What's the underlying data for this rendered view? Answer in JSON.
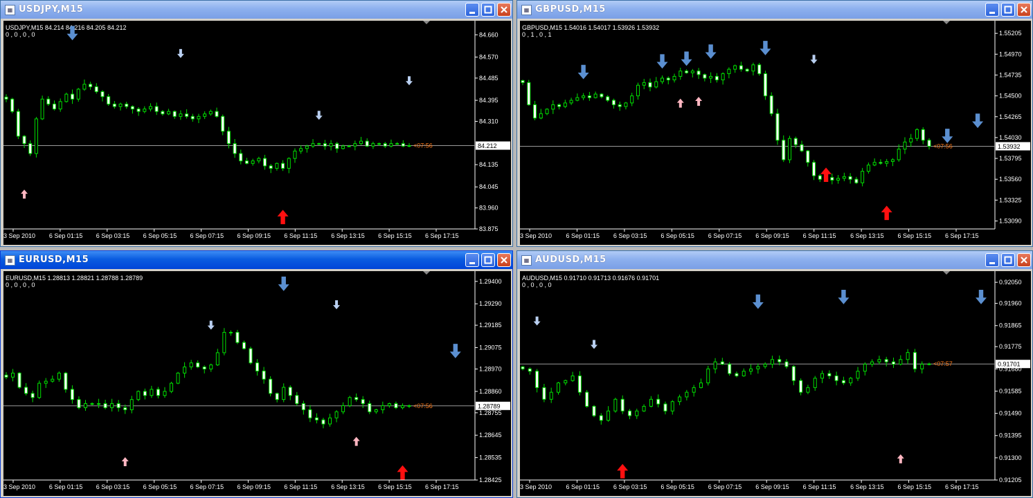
{
  "colors": {
    "bull": "#00ff00",
    "bear": "#ffffff",
    "wick": "#00e000",
    "axis": "#ffffff",
    "bidline": "#9a9a9a",
    "timer": "#ff7a1a",
    "up_light": "#ffb6c1",
    "up_bold": "#ff1010",
    "down_light": "#b9cff0",
    "down_bold": "#5b8fd0"
  },
  "icons": {
    "window": "chart-window-icon",
    "minimize": "minimize-icon",
    "maximize": "maximize-icon",
    "close": "close-icon"
  },
  "windows": [
    {
      "title": "USDJPY,M15",
      "active": false,
      "info_line1": "USDJPY,M15  84.214 84.216 84.205 84.212",
      "info_line2": "0 , 0 , 0 , 0",
      "price_labels": [
        "84.660",
        "84.570",
        "84.485",
        "84.395",
        "84.310",
        "84.135",
        "84.045",
        "83.960",
        "83.875"
      ],
      "bid_label": "84.212",
      "timer": "<07:56",
      "time_labels": [
        "3 Sep 2010",
        "6 Sep 01:15",
        "6 Sep 03:15",
        "6 Sep 05:15",
        "6 Sep 07:15",
        "6 Sep 09:15",
        "6 Sep 11:15",
        "6 Sep 13:15",
        "6 Sep 15:15",
        "6 Sep 17:15"
      ],
      "ymin": 83.875,
      "ymax": 84.7,
      "bid": 84.212,
      "series": [
        84.4,
        84.35,
        84.25,
        84.22,
        84.18,
        84.32,
        84.4,
        84.38,
        84.36,
        84.39,
        84.42,
        84.4,
        84.44,
        84.46,
        84.45,
        84.43,
        84.41,
        84.38,
        84.37,
        84.38,
        84.37,
        84.36,
        84.35,
        84.36,
        84.37,
        84.35,
        84.34,
        84.35,
        84.33,
        84.34,
        84.33,
        84.32,
        84.33,
        84.34,
        84.35,
        84.33,
        84.27,
        84.22,
        84.18,
        84.15,
        84.14,
        84.15,
        84.16,
        84.13,
        84.12,
        84.14,
        84.12,
        84.16,
        84.19,
        84.2,
        84.21,
        84.22,
        84.22,
        84.21,
        84.22,
        84.2,
        84.21,
        84.21,
        84.22,
        84.23,
        84.21,
        84.22,
        84.22,
        84.21,
        84.22,
        84.22,
        84.21,
        84.212
      ],
      "markers": [
        {
          "i": 11,
          "price": 84.66,
          "type": "down",
          "bold": true
        },
        {
          "i": 29,
          "price": 84.58,
          "type": "down",
          "bold": false
        },
        {
          "i": 52,
          "price": 84.33,
          "type": "down",
          "bold": false
        },
        {
          "i": 67,
          "price": 84.47,
          "type": "down",
          "bold": false
        },
        {
          "i": 3,
          "price": 84.02,
          "type": "up",
          "bold": false
        },
        {
          "i": 46,
          "price": 83.93,
          "type": "up",
          "bold": true
        }
      ]
    },
    {
      "title": "GBPUSD,M15",
      "active": false,
      "info_line1": "GBPUSD,M15  1.54016 1.54017 1.53926 1.53932",
      "info_line2": "0 , 1 , 0 , 1",
      "price_labels": [
        "1.55205",
        "1.54970",
        "1.54735",
        "1.54500",
        "1.54265",
        "1.54030",
        "1.53795",
        "1.53560",
        "1.53325",
        "1.53090"
      ],
      "bid_label": "1.53932",
      "timer": "<07:56",
      "time_labels": [
        "3 Sep 2010",
        "6 Sep 01:15",
        "6 Sep 03:15",
        "6 Sep 05:15",
        "6 Sep 07:15",
        "6 Sep 09:15",
        "6 Sep 11:15",
        "6 Sep 13:15",
        "6 Sep 15:15",
        "6 Sep 17:15"
      ],
      "ymin": 1.53,
      "ymax": 1.553,
      "bid": 1.53932,
      "series": [
        1.5465,
        1.544,
        1.5425,
        1.543,
        1.5435,
        1.544,
        1.5438,
        1.5442,
        1.5445,
        1.5448,
        1.545,
        1.5448,
        1.5452,
        1.5449,
        1.5445,
        1.544,
        1.5438,
        1.5442,
        1.545,
        1.5462,
        1.5465,
        1.546,
        1.5466,
        1.547,
        1.5468,
        1.5472,
        1.5478,
        1.5476,
        1.5478,
        1.5474,
        1.547,
        1.5472,
        1.5468,
        1.5475,
        1.548,
        1.5484,
        1.548,
        1.5478,
        1.5485,
        1.5475,
        1.545,
        1.543,
        1.54,
        1.5378,
        1.5402,
        1.5395,
        1.5388,
        1.5375,
        1.536,
        1.5356,
        1.5358,
        1.5355,
        1.5357,
        1.5359,
        1.5356,
        1.5352,
        1.5365,
        1.5372,
        1.5375,
        1.5374,
        1.5376,
        1.5378,
        1.539,
        1.5398,
        1.5402,
        1.5412,
        1.54,
        1.53932
      ],
      "markers": [
        {
          "i": 10,
          "price": 1.5475,
          "type": "down",
          "bold": true
        },
        {
          "i": 23,
          "price": 1.5487,
          "type": "down",
          "bold": true
        },
        {
          "i": 27,
          "price": 1.549,
          "type": "down",
          "bold": true
        },
        {
          "i": 31,
          "price": 1.5498,
          "type": "down",
          "bold": true
        },
        {
          "i": 40,
          "price": 1.5502,
          "type": "down",
          "bold": true
        },
        {
          "i": 48,
          "price": 1.549,
          "type": "down",
          "bold": false
        },
        {
          "i": 26,
          "price": 1.5443,
          "type": "up",
          "bold": false
        },
        {
          "i": 29,
          "price": 1.5445,
          "type": "up",
          "bold": false
        },
        {
          "i": 50,
          "price": 1.5363,
          "type": "up",
          "bold": true
        },
        {
          "i": 60,
          "price": 1.532,
          "type": "up",
          "bold": true
        },
        {
          "i": 70,
          "price": 1.5403,
          "type": "down",
          "bold": true
        },
        {
          "i": 75,
          "price": 1.542,
          "type": "down",
          "bold": true
        }
      ]
    },
    {
      "title": "EURUSD,M15",
      "active": true,
      "info_line1": "EURUSD,M15  1.28813 1.28821 1.28788 1.28789",
      "info_line2": "0 , 0 , 0 , 0",
      "price_labels": [
        "1.29400",
        "1.29290",
        "1.29185",
        "1.29075",
        "1.28970",
        "1.28860",
        "1.28755",
        "1.28645",
        "1.28535",
        "1.28425"
      ],
      "bid_label": "1.28789",
      "timer": "<07:56",
      "time_labels": [
        "3 Sep 2010",
        "6 Sep 01:15",
        "6 Sep 03:15",
        "6 Sep 05:15",
        "6 Sep 07:15",
        "6 Sep 09:15",
        "6 Sep 11:15",
        "6 Sep 13:15",
        "6 Sep 15:15",
        "6 Sep 17:15"
      ],
      "ymin": 1.28425,
      "ymax": 1.2943,
      "bid": 1.28789,
      "series": [
        1.2893,
        1.2895,
        1.2888,
        1.2885,
        1.2883,
        1.289,
        1.2891,
        1.2892,
        1.2895,
        1.2887,
        1.2882,
        1.2878,
        1.288,
        1.288,
        1.288,
        1.2878,
        1.288,
        1.2878,
        1.2877,
        1.2882,
        1.2886,
        1.2884,
        1.2887,
        1.2884,
        1.2886,
        1.289,
        1.2895,
        1.2898,
        1.29,
        1.2898,
        1.2897,
        1.2899,
        1.2905,
        1.2915,
        1.2915,
        1.291,
        1.2907,
        1.29,
        1.2896,
        1.2892,
        1.2885,
        1.2882,
        1.2888,
        1.2884,
        1.288,
        1.2877,
        1.2873,
        1.2872,
        1.287,
        1.2873,
        1.2876,
        1.2879,
        1.2883,
        1.2882,
        1.288,
        1.2876,
        1.2877,
        1.2879,
        1.288,
        1.2878,
        1.2879,
        1.28789
      ],
      "markers": [
        {
          "i": 42,
          "price": 1.2938,
          "type": "down",
          "bold": true
        },
        {
          "i": 31,
          "price": 1.2918,
          "type": "down",
          "bold": false
        },
        {
          "i": 50,
          "price": 1.2928,
          "type": "down",
          "bold": false
        },
        {
          "i": 68,
          "price": 1.2905,
          "type": "down",
          "bold": true
        },
        {
          "i": 18,
          "price": 1.2852,
          "type": "up",
          "bold": false
        },
        {
          "i": 53,
          "price": 1.2862,
          "type": "up",
          "bold": false
        },
        {
          "i": 60,
          "price": 1.2847,
          "type": "up",
          "bold": true
        }
      ]
    },
    {
      "title": "AUDUSD,M15",
      "active": false,
      "info_line1": "AUDUSD,M15  0.91710 0.91713 0.91676 0.91701",
      "info_line2": "0 , 0 , 0 , 0",
      "price_labels": [
        "0.92050",
        "0.91960",
        "0.91865",
        "0.91775",
        "0.91680",
        "0.91585",
        "0.91490",
        "0.91395",
        "0.91300",
        "0.91205"
      ],
      "bid_label": "0.91701",
      "timer": "<07:57",
      "time_labels": [
        "3 Sep 2010",
        "6 Sep 01:15",
        "6 Sep 03:15",
        "6 Sep 05:15",
        "6 Sep 07:15",
        "6 Sep 09:15",
        "6 Sep 11:15",
        "6 Sep 13:15",
        "6 Sep 15:15",
        "6 Sep 17:15"
      ],
      "ymin": 0.91205,
      "ymax": 0.9208,
      "bid": 0.91701,
      "series": [
        0.9168,
        0.9167,
        0.916,
        0.9155,
        0.9158,
        0.9162,
        0.9163,
        0.9165,
        0.9158,
        0.9152,
        0.9148,
        0.9146,
        0.915,
        0.9155,
        0.915,
        0.9148,
        0.915,
        0.9152,
        0.9155,
        0.9153,
        0.915,
        0.9154,
        0.9156,
        0.9158,
        0.916,
        0.9162,
        0.9168,
        0.9171,
        0.917,
        0.9166,
        0.9165,
        0.9167,
        0.9168,
        0.9169,
        0.917,
        0.9172,
        0.9171,
        0.9169,
        0.9163,
        0.9158,
        0.916,
        0.9164,
        0.9166,
        0.9165,
        0.9163,
        0.9162,
        0.9164,
        0.9167,
        0.917,
        0.9171,
        0.9172,
        0.9171,
        0.917,
        0.9172,
        0.9175,
        0.9168,
        0.917,
        0.91701
      ],
      "markers": [
        {
          "i": 2,
          "price": 0.9188,
          "type": "down",
          "bold": false
        },
        {
          "i": 10,
          "price": 0.9178,
          "type": "down",
          "bold": false
        },
        {
          "i": 33,
          "price": 0.9196,
          "type": "down",
          "bold": true
        },
        {
          "i": 45,
          "price": 0.9198,
          "type": "down",
          "bold": true
        },
        {
          "i": 65,
          "price": 0.9198,
          "type": "down",
          "bold": true
        },
        {
          "i": 14,
          "price": 0.9125,
          "type": "up",
          "bold": true
        },
        {
          "i": 53,
          "price": 0.913,
          "type": "up",
          "bold": false
        }
      ]
    }
  ]
}
